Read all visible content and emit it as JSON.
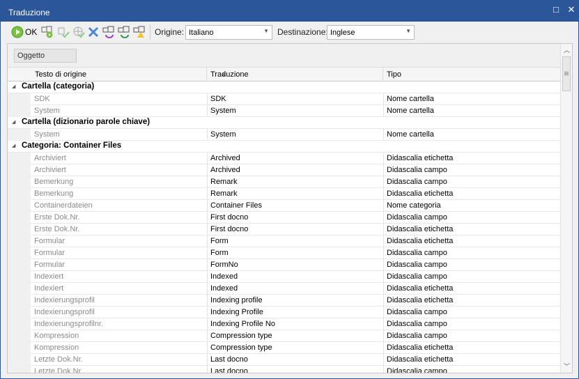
{
  "window": {
    "title": "Traduzione",
    "maximize_icon": "□",
    "close_icon": "✕"
  },
  "toolbar": {
    "ok_label": "OK",
    "origin_label": "Origine:",
    "origin_value": "Italiano",
    "dest_label": "Destinazione:",
    "dest_value": "Inglese",
    "icons": [
      "ok-play-icon",
      "translate-run-icon",
      "accept-icon",
      "accept-web-icon",
      "delete-icon",
      "translate-purple-icon",
      "translate-green-icon",
      "translate-warning-icon"
    ]
  },
  "grouping": {
    "chip": "Oggetto"
  },
  "columns": [
    "Testo di origine",
    "Traduzione",
    "Tipo"
  ],
  "rows": [
    {
      "group": "Cartella (categoria)"
    },
    {
      "src": "SDK",
      "tr": "SDK",
      "type": "Nome cartella"
    },
    {
      "src": "System",
      "tr": "System",
      "type": "Nome cartella"
    },
    {
      "group": "Cartella (dizionario parole chiave)"
    },
    {
      "src": "System",
      "tr": "System",
      "type": "Nome cartella"
    },
    {
      "group": "Categoria: Container Files"
    },
    {
      "src": "Archiviert",
      "tr": "Archived",
      "type": "Didascalia etichetta"
    },
    {
      "src": "Archiviert",
      "tr": "Archived",
      "type": "Didascalia campo"
    },
    {
      "src": "Bemerkung",
      "tr": "Remark",
      "type": "Didascalia campo"
    },
    {
      "src": "Bemerkung",
      "tr": "Remark",
      "type": "Didascalia etichetta"
    },
    {
      "src": "Containerdateien",
      "tr": "Container Files",
      "type": "Nome categoria"
    },
    {
      "src": "Erste Dok.Nr.",
      "tr": "First docno",
      "type": "Didascalia campo"
    },
    {
      "src": "Erste Dok.Nr.",
      "tr": "First docno",
      "type": "Didascalia etichetta"
    },
    {
      "src": "Formular",
      "tr": "Form",
      "type": "Didascalia etichetta"
    },
    {
      "src": "Formular",
      "tr": "Form",
      "type": "Didascalia campo"
    },
    {
      "src": "Formular",
      "tr": "FormNo",
      "type": "Didascalia campo"
    },
    {
      "src": "Indexiert",
      "tr": "Indexed",
      "type": "Didascalia campo"
    },
    {
      "src": "Indexiert",
      "tr": "Indexed",
      "type": "Didascalia etichetta"
    },
    {
      "src": "Indexierungsprofil",
      "tr": "Indexing profile",
      "type": "Didascalia etichetta"
    },
    {
      "src": "Indexierungsprofil",
      "tr": "Indexing Profile",
      "type": "Didascalia campo"
    },
    {
      "src": "Indexierungsprofilnr.",
      "tr": "Indexing Profile No",
      "type": "Didascalia campo"
    },
    {
      "src": "Kompression",
      "tr": "Compression type",
      "type": "Didascalia campo"
    },
    {
      "src": "Kompression",
      "tr": "Compression type",
      "type": "Didascalia etichetta"
    },
    {
      "src": "Letzte Dok.Nr.",
      "tr": "Last docno",
      "type": "Didascalia etichetta"
    },
    {
      "src": "Letzte Dok.Nr.",
      "tr": "Last docno",
      "type": "Didascalia campo"
    }
  ]
}
